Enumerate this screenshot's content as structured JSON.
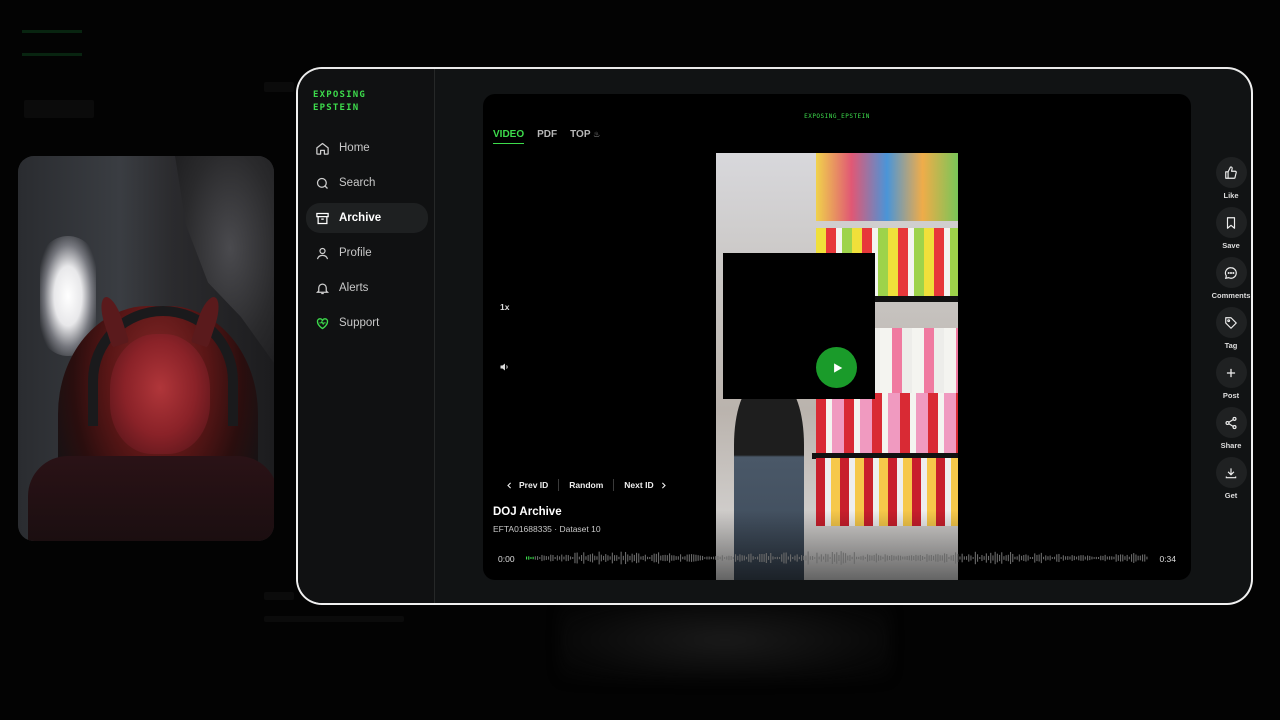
{
  "brand": {
    "line1": "EXPOSING",
    "line2": "EPSTEIN",
    "color": "#3ddc4c"
  },
  "sidebar": {
    "items": [
      {
        "label": "Home",
        "icon": "home-icon",
        "active": false
      },
      {
        "label": "Search",
        "icon": "search-icon",
        "active": false
      },
      {
        "label": "Archive",
        "icon": "archive-icon",
        "active": true
      },
      {
        "label": "Profile",
        "icon": "user-icon",
        "active": false
      },
      {
        "label": "Alerts",
        "icon": "bell-icon",
        "active": false
      },
      {
        "label": "Support",
        "icon": "heart-icon",
        "active": false
      }
    ]
  },
  "player": {
    "brand": "EXPOSING_EPSTEIN",
    "tabs": [
      "VIDEO",
      "PDF",
      "TOP"
    ],
    "active_tab": "VIDEO",
    "speed": "1x",
    "id_nav": {
      "prev": "Prev ID",
      "random": "Random",
      "next": "Next ID"
    },
    "title": "DOJ Archive",
    "subtitle": "EFTA01688335 · Dataset 10",
    "time_current": "0:00",
    "time_total": "0:34",
    "progress": 0.0
  },
  "actions": [
    {
      "label": "Like",
      "icon": "thumbs-up-icon"
    },
    {
      "label": "Save",
      "icon": "bookmark-icon"
    },
    {
      "label": "Comments",
      "icon": "comment-icon"
    },
    {
      "label": "Tag",
      "icon": "tag-icon"
    },
    {
      "label": "Post",
      "icon": "plus-icon"
    },
    {
      "label": "Share",
      "icon": "share-icon"
    },
    {
      "label": "Get",
      "icon": "download-icon"
    }
  ],
  "colors": {
    "accent": "#3ddc4c",
    "play": "#1a9b2a",
    "frame_bg": "#111314"
  }
}
